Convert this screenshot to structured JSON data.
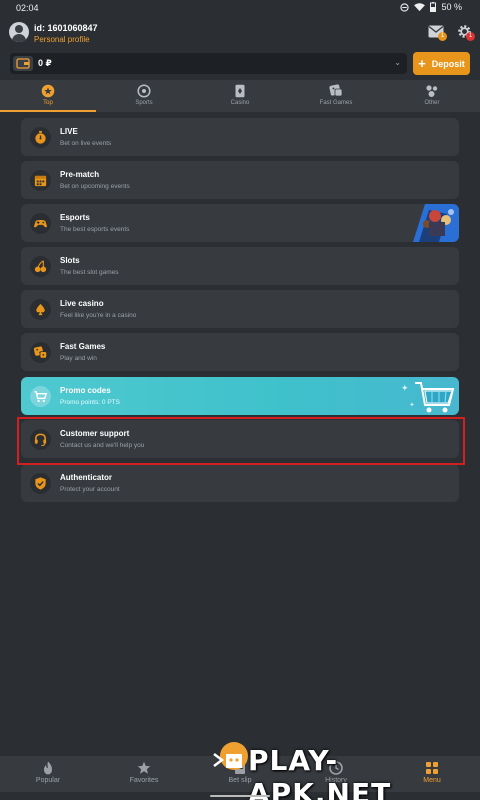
{
  "status_bar": {
    "time": "02:04",
    "battery": "50 %"
  },
  "header": {
    "user_id": "id: 1601060847",
    "profile_link": "Personal profile",
    "messages_badge": "1",
    "settings_badge": "1"
  },
  "balance": {
    "value": "0 ₽",
    "deposit_label": "Deposit"
  },
  "tabs": [
    {
      "label": "Top",
      "icon": "star-icon",
      "active": true
    },
    {
      "label": "Sports",
      "icon": "soccer-ball-icon",
      "active": false
    },
    {
      "label": "Casino",
      "icon": "card-icon",
      "active": false
    },
    {
      "label": "Fast Games",
      "icon": "dice-icon",
      "active": false
    },
    {
      "label": "Other",
      "icon": "bubbles-icon",
      "active": false
    }
  ],
  "menu": [
    {
      "title": "LIVE",
      "subtitle": "Bet on live events",
      "icon": "stopwatch-icon"
    },
    {
      "title": "Pre-match",
      "subtitle": "Bet on upcoming events",
      "icon": "calendar-icon"
    },
    {
      "title": "Esports",
      "subtitle": "The best esports events",
      "icon": "gamepad-icon"
    },
    {
      "title": "Slots",
      "subtitle": "The best slot games",
      "icon": "cherries-icon"
    },
    {
      "title": "Live casino",
      "subtitle": "Feel like you're in a casino",
      "icon": "spade-icon"
    },
    {
      "title": "Fast Games",
      "subtitle": "Play and win",
      "icon": "dice-icon"
    },
    {
      "title": "Promo codes",
      "subtitle": "Promo points: 0 PTS",
      "icon": "cart-icon"
    },
    {
      "title": "Customer support",
      "subtitle": "Contact us and we'll help you",
      "icon": "headset-icon"
    },
    {
      "title": "Authenticator",
      "subtitle": "Protect your account",
      "icon": "shield-check-icon"
    }
  ],
  "bottom_nav": [
    {
      "label": "Popular",
      "icon": "flame-icon",
      "active": false
    },
    {
      "label": "Favorites",
      "icon": "star-icon",
      "active": false
    },
    {
      "label": "Bet slip",
      "icon": "ticket-icon",
      "active": false
    },
    {
      "label": "History",
      "icon": "clock-icon",
      "active": false
    },
    {
      "label": "Menu",
      "icon": "menu-grid-icon",
      "active": true
    }
  ],
  "watermark": "PLAY-APK.NET",
  "colors": {
    "accent": "#f0a030",
    "background": "#2b2f33",
    "card": "#373b40",
    "promo": "#4fc9d0",
    "highlight": "#d21f1f"
  }
}
